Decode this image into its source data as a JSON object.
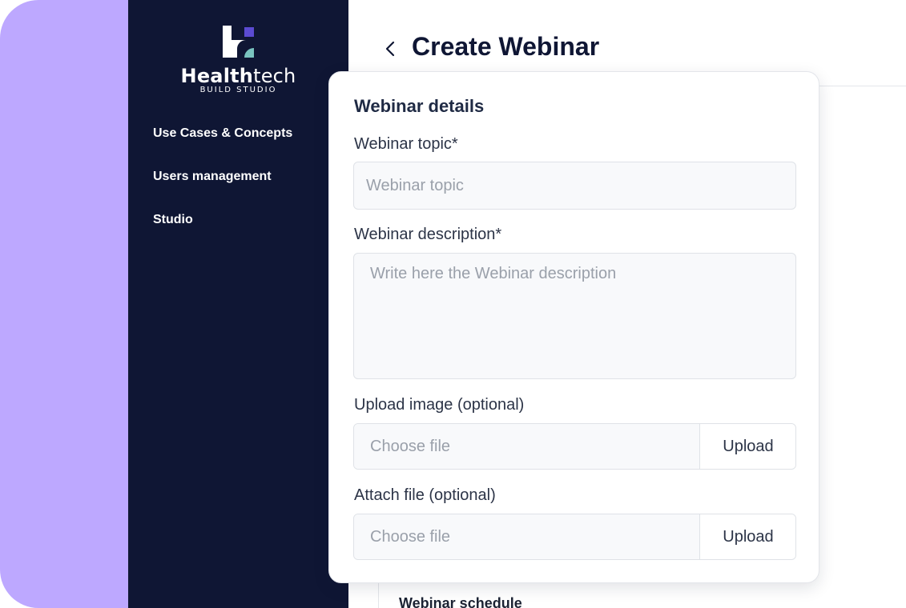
{
  "brand": {
    "name_bold": "Health",
    "name_light": "tech",
    "subtitle": "BUILD STUDIO",
    "accent_purple": "#5b4bd1",
    "accent_teal": "#7ac4c0"
  },
  "sidebar": {
    "items": [
      {
        "label": "Use Cases & Concepts"
      },
      {
        "label": "Users management"
      },
      {
        "label": "Studio"
      }
    ]
  },
  "header": {
    "title": "Create Webinar",
    "back_icon": "chevron-left-icon"
  },
  "form": {
    "title": "Webinar details",
    "topic_label": "Webinar topic*",
    "topic_placeholder": "Webinar topic",
    "description_label": "Webinar description*",
    "description_placeholder": "Write here the Webinar description",
    "image_label": "Upload image (optional)",
    "image_placeholder": "Choose file",
    "image_button": "Upload",
    "file_label": "Attach file (optional)",
    "file_placeholder": "Choose file",
    "file_button": "Upload"
  },
  "background": {
    "section_label": "Webinar schedule"
  }
}
